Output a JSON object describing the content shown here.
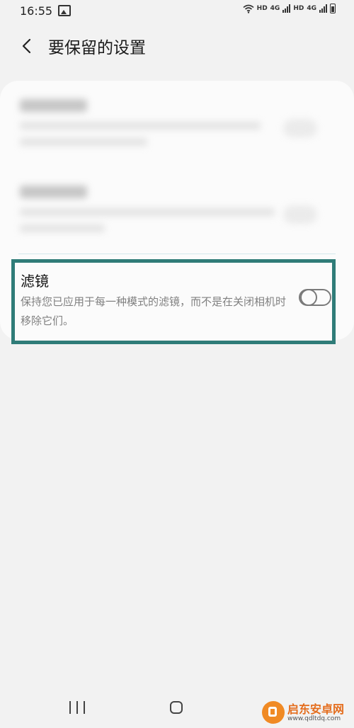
{
  "status_bar": {
    "time": "16:55",
    "hd1": "HD",
    "net1": "4G",
    "hd2": "HD",
    "net2": "4G",
    "icons": [
      "gallery-icon",
      "wifi-icon",
      "signal-icon",
      "battery-icon"
    ]
  },
  "header": {
    "back_icon": "chevron-left-icon",
    "title": "要保留的设置"
  },
  "settings": {
    "filter": {
      "title": "滤镜",
      "description": "保持您已应用于每一种模式的滤镜，而不是在关闭相机时移除它们。",
      "enabled": false
    }
  },
  "nav_bar": {
    "icons": [
      "recent-apps-icon",
      "home-icon",
      "back-icon"
    ]
  },
  "watermark": {
    "name": "启东安卓网",
    "url": "www.qdltdq.com"
  },
  "colors": {
    "highlight": "#2f7c78",
    "background": "#f2f2f2",
    "card": "#fbfbfb",
    "watermark": "#e46d1d"
  }
}
